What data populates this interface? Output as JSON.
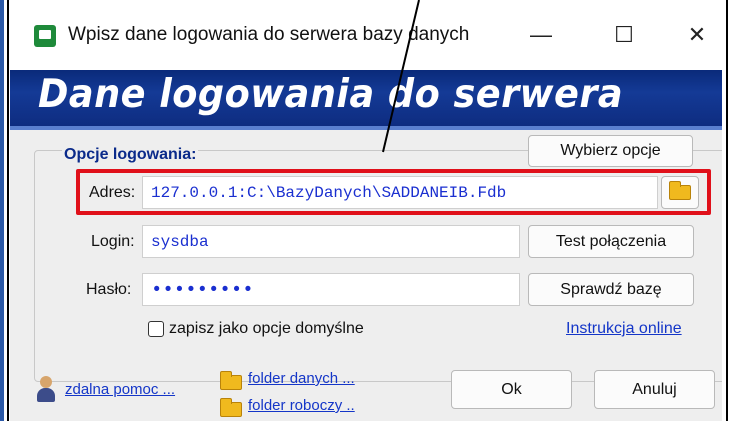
{
  "window": {
    "title": "Wpisz dane logowania do serwera bazy danych",
    "minimize_glyph": "—",
    "maximize_glyph": "☐",
    "close_glyph": "✕"
  },
  "banner": {
    "text": "Dane logowania do serwera"
  },
  "options": {
    "group_title": "Opcje logowania:",
    "choose_button": "Wybierz opcje"
  },
  "fields": {
    "address_label": "Adres:",
    "address_value": "127.0.0.1:C:\\BazyDanych\\SADDANEIB.Fdb",
    "login_label": "Login:",
    "login_value": "sysdba",
    "password_label": "Hasło:",
    "password_value": "•••••••••"
  },
  "buttons": {
    "test_connection": "Test połączenia",
    "check_database": "Sprawdź bazę",
    "ok": "Ok",
    "cancel": "Anuluj"
  },
  "checkbox": {
    "label": "zapisz jako opcje domyślne",
    "checked": false
  },
  "links": {
    "online_instructions": "Instrukcja online",
    "remote_help": "zdalna pomoc ...",
    "data_folder": "folder danych ...",
    "work_folder": "folder roboczy .."
  },
  "colors": {
    "banner_bg": "#143a96",
    "highlight_border": "#e0101a",
    "field_text": "#1a2fd0",
    "group_title": "#0a2a8a"
  },
  "icons": {
    "app": "app-icon",
    "browse": "folder-icon",
    "remote_help": "person-icon"
  }
}
